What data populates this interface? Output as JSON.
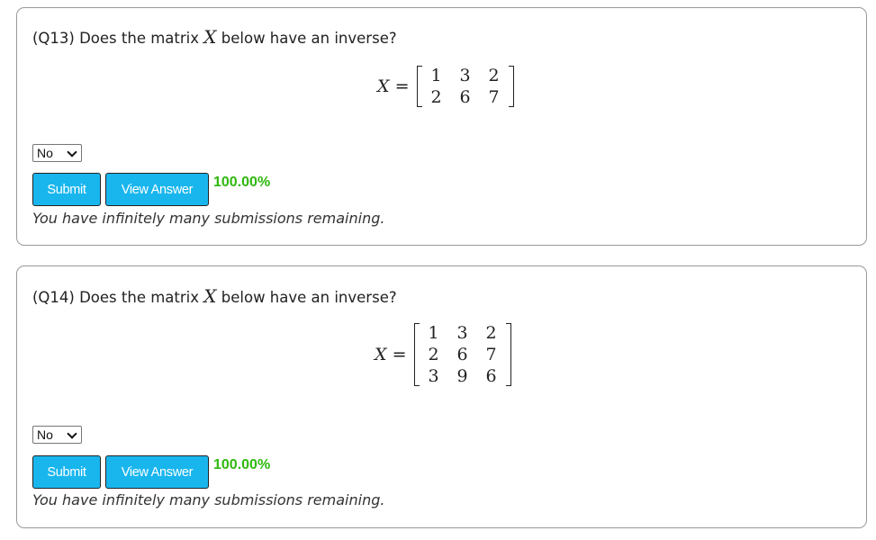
{
  "questions": [
    {
      "label": "(Q13) Does the matrix",
      "variable": "X",
      "suffix": "below have an inverse?",
      "equation_lhs": "X",
      "equation_eq": "=",
      "matrix": [
        [
          "1",
          "3",
          "2"
        ],
        [
          "2",
          "6",
          "7"
        ]
      ],
      "answer_selected": "No",
      "submit_label": "Submit",
      "view_answer_label": "View Answer",
      "score": "100.00%",
      "remaining_text": "You have infinitely many submissions remaining."
    },
    {
      "label": "(Q14) Does the matrix",
      "variable": "X",
      "suffix": "below have an inverse?",
      "equation_lhs": "X",
      "equation_eq": "=",
      "matrix": [
        [
          "1",
          "3",
          "2"
        ],
        [
          "2",
          "6",
          "7"
        ],
        [
          "3",
          "9",
          "6"
        ]
      ],
      "answer_selected": "No",
      "submit_label": "Submit",
      "view_answer_label": "View Answer",
      "score": "100.00%",
      "remaining_text": "You have infinitely many submissions remaining."
    }
  ],
  "colors": {
    "button_bg": "#19b6ee",
    "score_green": "#2fb80f",
    "card_border": "#999999"
  }
}
